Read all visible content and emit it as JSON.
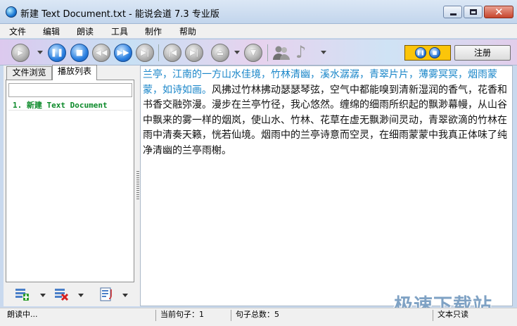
{
  "window": {
    "title": "新建 Text Document.txt - 能说会道 7.3 专业版"
  },
  "menu": {
    "items": [
      "文件",
      "编辑",
      "朗读",
      "工具",
      "制作",
      "帮助"
    ]
  },
  "toolbar": {
    "register_label": "注册",
    "buttons": [
      "play-icon",
      "pause-icon",
      "stop-icon",
      "rewind-icon",
      "fast-forward-icon",
      "next-icon",
      "first-icon",
      "last-icon",
      "eject-icon",
      "down-icon",
      "users-icon",
      "music-note-icon"
    ]
  },
  "sidebar": {
    "tabs": [
      "文件浏览",
      "播放列表"
    ],
    "active_tab": "播放列表",
    "playlist": [
      "1. 新建 Text Document"
    ],
    "tools": [
      "add-list-icon",
      "remove-list-icon",
      "list-settings-icon"
    ]
  },
  "document": {
    "read_text": "兰亭，江南的一方山水佳境，竹林清幽，溪水潺潺，青翠片片，薄雾冥冥，烟雨蒙蒙，如诗如画。",
    "rest_text": "风拂过竹林拂动瑟瑟琴弦，空气中都能嗅到清新湿润的香气，花香和书香交融弥漫。漫步在兰亭竹径，我心悠然。缠绵的细雨所织起的飘渺幕幔，从山谷中飘来的雾一样的烟岚，使山水、竹林、花草在虚无飘渺间灵动，青翠欲滴的竹林在雨中清奏天籁，恍若仙境。烟雨中的兰亭诗意而空灵，在细雨蒙蒙中我真正体味了纯净清幽的兰亭雨榭。"
  },
  "status": {
    "state": "朗读中...",
    "current_sentence": "当前句子：1",
    "total_sentences": "句子总数：5",
    "mode": "文本只读"
  },
  "watermark": "极速下载站",
  "colors": {
    "read_text": "#1a86c9",
    "playlist_text": "#0c8a2a",
    "mini_panel": "#fbc50a"
  }
}
